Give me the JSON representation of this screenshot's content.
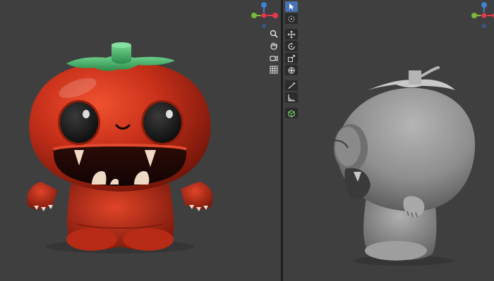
{
  "gizmo": {
    "x_color": "#e8384f",
    "y_color": "#7bb83c",
    "z_color": "#3d82d5",
    "labels": {
      "x": "X",
      "y": "Y",
      "z": "Z"
    }
  },
  "navigation_icons": [
    "zoom-icon",
    "hand-pan-icon",
    "camera-icon",
    "grid-icon"
  ],
  "toolbar": {
    "tools": [
      "select-cursor-icon",
      "cursor-3d-icon",
      "move-icon",
      "rotate-icon",
      "scale-icon",
      "transform-icon",
      "annotate-icon",
      "measure-icon",
      "add-cube-icon"
    ],
    "active_tool": "select-cursor-icon",
    "accent": "#4772b3"
  },
  "viewports": {
    "left": {
      "shading": "rendered",
      "subject_colors": {
        "body": "#c62f17",
        "leaf": "#3faa5f",
        "eyes": "#141414",
        "teeth": "#efd9c4"
      }
    },
    "right": {
      "shading": "solid",
      "subject_colors": {
        "body": "#9a9a9a"
      }
    }
  },
  "colors": {
    "viewport_bg": "#3f3f3f",
    "divider": "#1e1e1e",
    "tool_bg": "#2b2b2b"
  }
}
